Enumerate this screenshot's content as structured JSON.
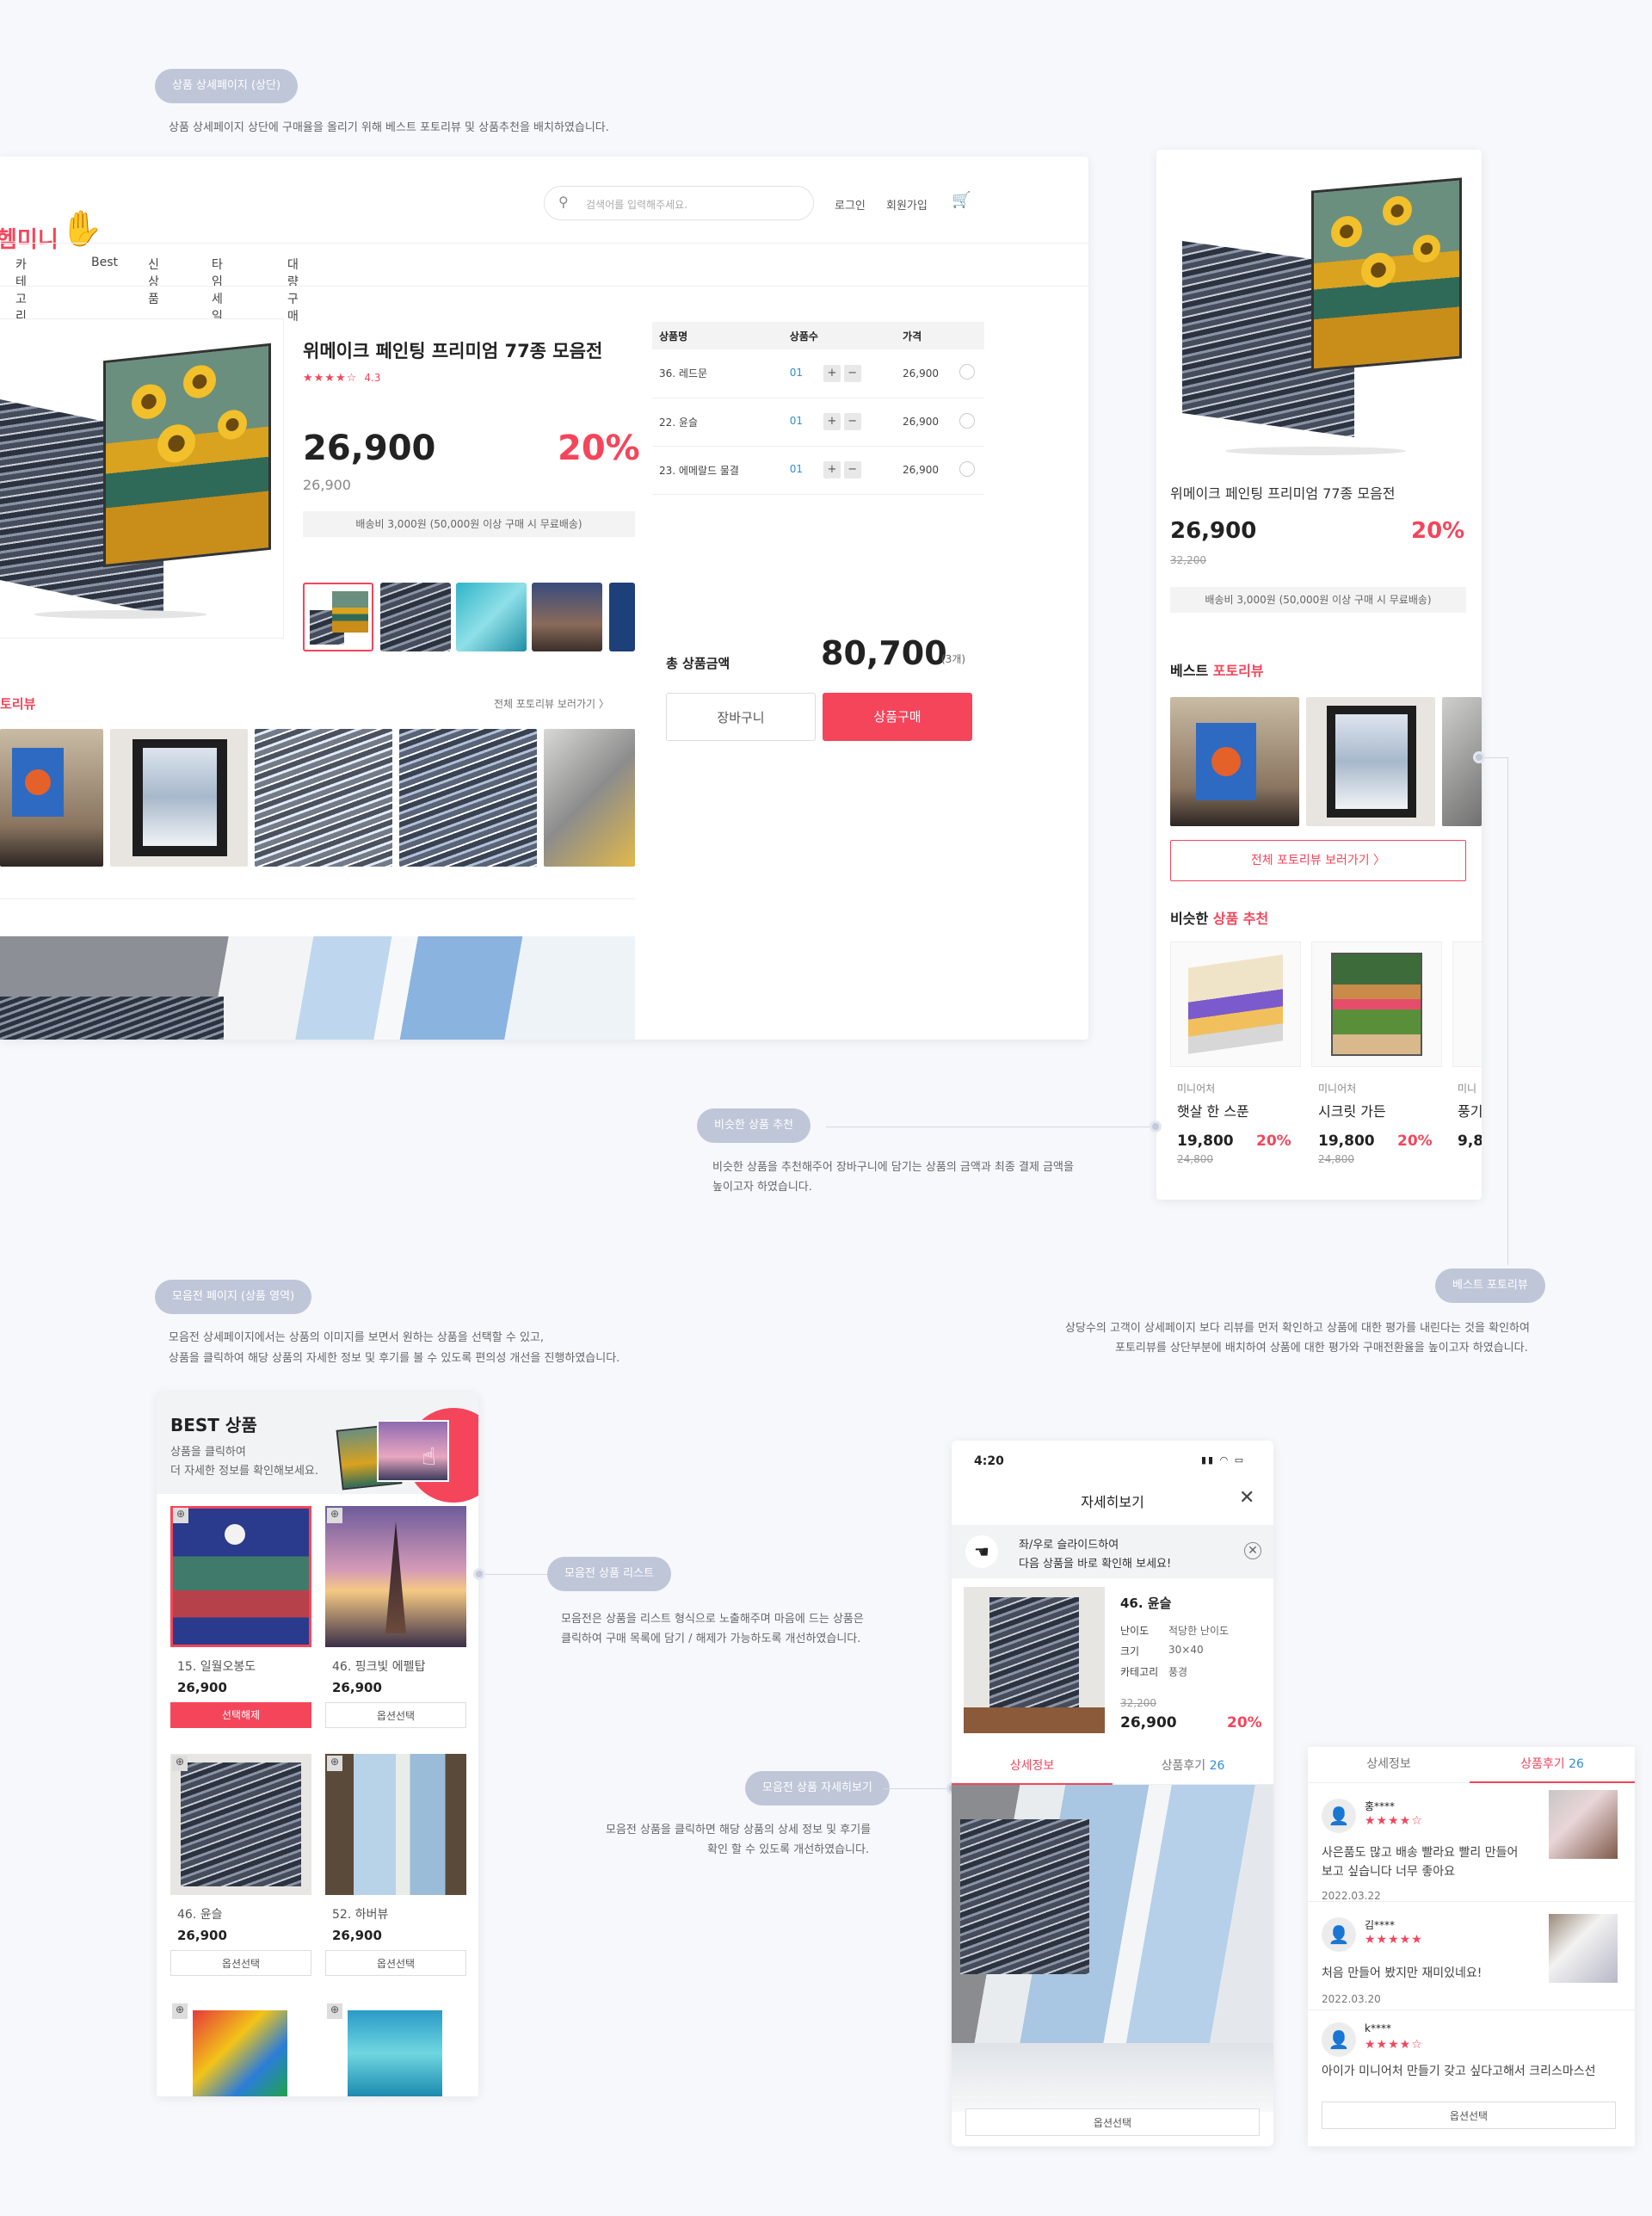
{
  "annotations": {
    "top_pill": "상품 상세페이지 (상단)",
    "top_note": "상품 상세페이지 상단에 구매율을 올리기 위해 베스트 포토리뷰 및 상품추천을 배치하였습니다.",
    "similar_pill": "비슷한 상품 추천",
    "similar_note": [
      "비슷한 상품을 추천해주어 장바구니에 담기는 상품의 금액과 최종 결제 금액을",
      "높이고자 하였습니다."
    ],
    "best_pill": "베스트 포토리뷰",
    "best_note": [
      "상당수의 고객이 상세페이지 보다 리뷰를 먼저 확인하고 상품에 대한 평가를 내린다는 것을 확인하여",
      "포토리뷰를 상단부분에 배치하여 상품에 대한 평가와 구매전환율을 높이고자 하였습니다."
    ],
    "collection_pill": "모음전 페이지 (상품 영역)",
    "collection_note": [
      "모음전 상세페이지에서는 상품의 이미지를 보면서 원하는 상품을 선택할 수 있고,",
      "상품을 클릭하여 해당 상품의 자세한 정보 및 후기를 볼 수 있도록 편의성 개선을 진행하였습니다."
    ],
    "list_pill": "모음전 상품 리스트",
    "list_note": [
      "모음전은 상품을 리스트 형식으로 노출해주며 마음에 드는 상품은",
      "클릭하여 구매 목록에 담기 / 해제가 가능하도록 개선하였습니다."
    ],
    "detail_pill": "모음전 상품 자세히보기",
    "detail_note": [
      "모음전 상품을 클릭하면 해당 상품의 상세 정보 및 후기를",
      "확인 할 수 있도록 개선하였습니다."
    ]
  },
  "desktop": {
    "logo": "헴미니",
    "search_placeholder": "검색어를 입력해주세요.",
    "login": "로그인",
    "signup": "회원가입",
    "nav": [
      "카테고리",
      "Best",
      "신상품",
      "타임세일",
      "대량구매"
    ],
    "product_title": "위메이크 페인팅 프리미엄 77종 모음전",
    "stars": "★★★★☆",
    "rating": "4.3",
    "price": "26,900",
    "discount": "20%",
    "orig_price": "26,900",
    "shipping": "배송비 3,000원 (50,000원 이상 구매 시 무료배송)",
    "review_title_tail": "토리뷰",
    "review_more": "전체 포토리뷰 보러가기  〉",
    "table_headers": [
      "상품명",
      "상품수",
      "가격"
    ],
    "table_rows": [
      {
        "name": "36. 레드문",
        "qty": "01",
        "price": "26,900"
      },
      {
        "name": "22. 윤슬",
        "qty": "01",
        "price": "26,900"
      },
      {
        "name": "23. 에메랄드 물결",
        "qty": "01",
        "price": "26,900"
      }
    ],
    "total_label": "총 상품금액",
    "total_price": "80,700",
    "total_count": "(3개)",
    "cart_btn": "장바구니",
    "buy_btn": "상품구매"
  },
  "mobile_detail": {
    "product_title": "위메이크 페인팅 프리미엄 77종 모음전",
    "price": "26,900",
    "discount": "20%",
    "orig_price": "32,200",
    "shipping": "배송비 3,000원 (50,000원 이상 구매 시 무료배송)",
    "best_review_a": "베스트 ",
    "best_review_b": "포토리뷰",
    "review_more": "전체 포토리뷰 보러가기  〉",
    "similar_a": "비슷한 ",
    "similar_b": "상품 추천",
    "recs": [
      {
        "brand": "미니어처",
        "name": "햇살 한 스푼",
        "price": "19,800",
        "discount": "20%",
        "orig": "24,800"
      },
      {
        "brand": "미니어처",
        "name": "시크릿 가든",
        "price": "19,800",
        "discount": "20%",
        "orig": "24,800"
      },
      {
        "brand": "미니",
        "name": "풍기",
        "price": "9,8",
        "discount": "",
        "orig": ""
      }
    ]
  },
  "collection": {
    "title": "BEST 상품",
    "subtitle": [
      "상품을 클릭하여",
      "더 자세한 정보를 확인해보세요."
    ],
    "items": [
      {
        "name": "15. 일월오봉도",
        "price": "26,900",
        "btn": "선택해제"
      },
      {
        "name": "46. 핑크빛 에펠탑",
        "price": "26,900",
        "btn": "옵션선택"
      },
      {
        "name": "46. 윤슬",
        "price": "26,900",
        "btn": "옵션선택"
      },
      {
        "name": "52. 하버뷰",
        "price": "26,900",
        "btn": "옵션선택"
      }
    ]
  },
  "phone": {
    "time": "4:20",
    "header": "자세히보기",
    "swipe_a": "좌/우로 슬라이드하여",
    "swipe_b": "다음 상품을 바로 확인해 보세요!",
    "item_name": "46. 윤슬",
    "spec_labels": [
      "난이도",
      "크기",
      "카테고리"
    ],
    "spec_values": [
      "적당한 난이도",
      "30×40",
      "풍경"
    ],
    "orig": "32,200",
    "price": "26,900",
    "discount": "20%",
    "tab_info": "상세정보",
    "tab_review": "상품후기",
    "review_count": "26",
    "option_btn": "옵션선택"
  },
  "reviews": {
    "tab_info": "상세정보",
    "tab_review": "상품후기",
    "count": "26",
    "items": [
      {
        "user": "홍****",
        "stars": "★★★★☆",
        "text": [
          "사은품도 많고 배송 빨라요 빨리 만들어",
          "보고 싶습니다 너무 좋아요"
        ],
        "date": "2022.03.22"
      },
      {
        "user": "김****",
        "stars": "★★★★★",
        "text": [
          "처음 만들어 봤지만 재미있네요!"
        ],
        "date": "2022.03.20"
      },
      {
        "user": "k****",
        "stars": "★★★★☆",
        "text": [
          "아이가 미니어처 만들기 갖고 싶다고해서 크리스마스선"
        ],
        "date": ""
      }
    ],
    "option_btn": "옵션선택"
  },
  "colors": {
    "accent": "#f5455b",
    "blue": "#2e8ed8",
    "pill": "#bfc6d8",
    "bg": "#f7f8fc"
  }
}
